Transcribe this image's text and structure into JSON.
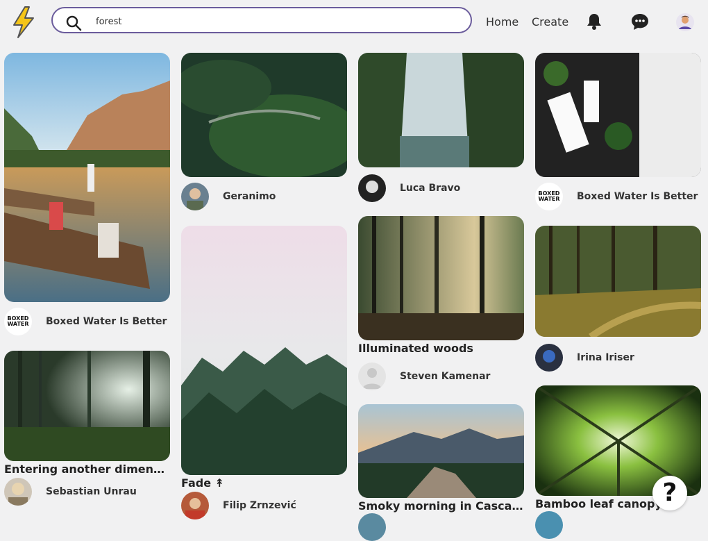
{
  "search": {
    "value": "forest",
    "placeholder": "Search"
  },
  "nav": {
    "home": "Home",
    "create": "Create"
  },
  "help": "?",
  "pins": [
    {
      "caption": "",
      "author": "Boxed Water Is Better",
      "avatar_text": "BOXED WATER"
    },
    {
      "caption": "Entering another dimension...",
      "author": "Sebastian Unrau"
    },
    {
      "caption": "",
      "author": "Geranimo"
    },
    {
      "caption": "Fade ↟",
      "author": "Filip Zrnzević"
    },
    {
      "caption": "",
      "author": "Luca Bravo"
    },
    {
      "caption": "Illuminated woods",
      "author": "Steven Kamenar"
    },
    {
      "caption": "Smoky morning in Cascades",
      "author": ""
    },
    {
      "caption": "",
      "author": "Boxed Water Is Better",
      "avatar_text": "BOXED WATER"
    },
    {
      "caption": "",
      "author": "Irina Iriser"
    },
    {
      "caption": "Bamboo leaf canopy",
      "author": ""
    }
  ]
}
